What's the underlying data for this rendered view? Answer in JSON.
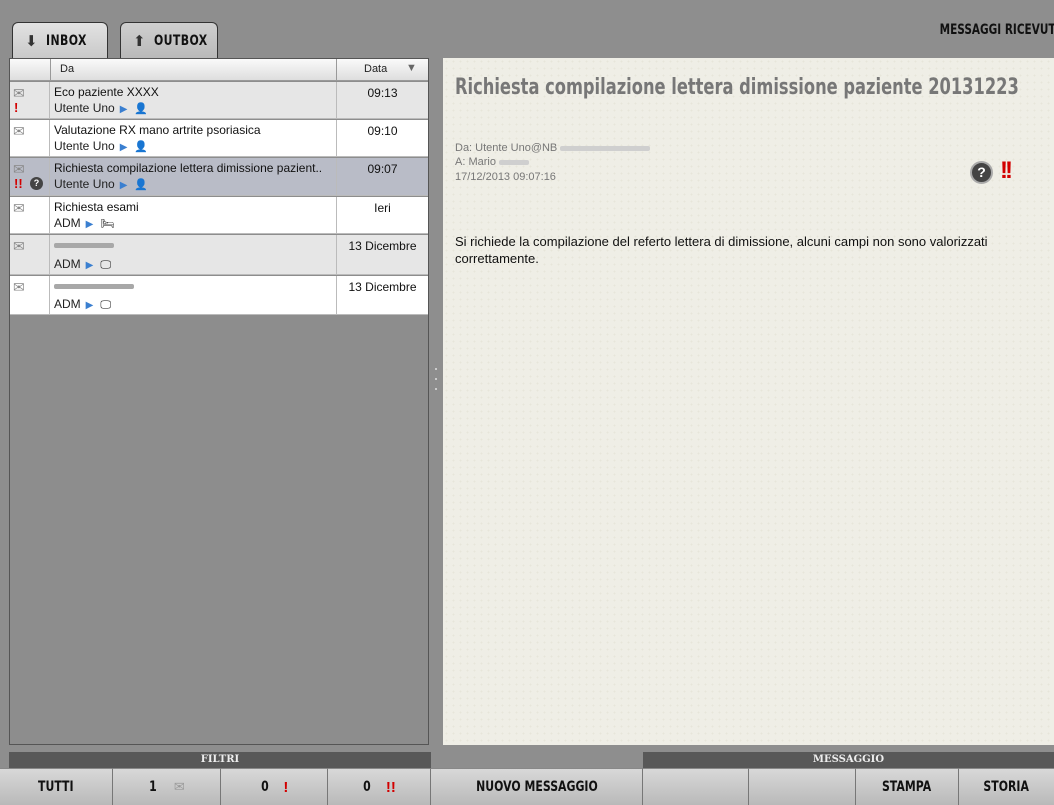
{
  "tabs": [
    {
      "label": "INBOX",
      "icon": "inbox-arrow-icon",
      "active": true
    },
    {
      "label": "OUTBOX",
      "icon": "outbox-arrow-icon",
      "active": false
    }
  ],
  "section_title": "MESSAGGI RICEVUT",
  "list": {
    "headers": {
      "from": "Da",
      "date": "Data"
    },
    "rows": [
      {
        "subject": "Eco paziente XXXX",
        "sender": "Utente Uno",
        "sender_type": "person-icon",
        "date": "09:13",
        "urgent": "!",
        "read": true,
        "selected": false
      },
      {
        "subject": "Valutazione RX mano artrite psoriasica",
        "sender": "Utente Uno",
        "sender_type": "person-icon",
        "date": "09:10",
        "read": true,
        "selected": false
      },
      {
        "subject": "Richiesta compilazione lettera dimissione pazient..",
        "sender": "Utente Uno",
        "sender_type": "person-icon",
        "date": "09:07",
        "urgent": "!!",
        "question": "?",
        "read": true,
        "selected": true
      },
      {
        "subject": "Richiesta esami",
        "sender": "ADM",
        "sender_type": "bed-icon",
        "date": "Ieri",
        "read": true,
        "selected": false
      },
      {
        "subject": "",
        "sender": "ADM",
        "sender_type": "monitor-icon",
        "date": "13 Dicembre",
        "read": true,
        "selected": false
      },
      {
        "subject": "",
        "sender": "ADM",
        "sender_type": "monitor-icon",
        "date": "13 Dicembre",
        "read": false,
        "selected": false
      }
    ]
  },
  "message": {
    "subject": "Richiesta compilazione lettera dimissione paziente 20131223",
    "from_label": "Da: Utente Uno@NB",
    "to_label": "A: Mario",
    "datetime": "17/12/2013 09:07:16",
    "question": "?",
    "urgent": "!!",
    "body": "Si richiede la compilazione del referto lettera di dimissione, alcuni campi non sono valorizzati correttamente."
  },
  "footer": {
    "filters_label": "FILTRI",
    "message_label": "MESSAGGIO",
    "buttons": {
      "all": "TUTTI",
      "unread_count": "1",
      "urgent_count": "0",
      "very_urgent_count": "0",
      "urgent_mark": "!",
      "very_urgent_mark": "!!",
      "new_message": "NUOVO MESSAGGIO",
      "print": "STAMPA",
      "history": "STORIA"
    }
  },
  "colors": {
    "urgent": "#d20000",
    "selected_row": "#b9bcc7",
    "arrow": "#3a7fd0"
  }
}
